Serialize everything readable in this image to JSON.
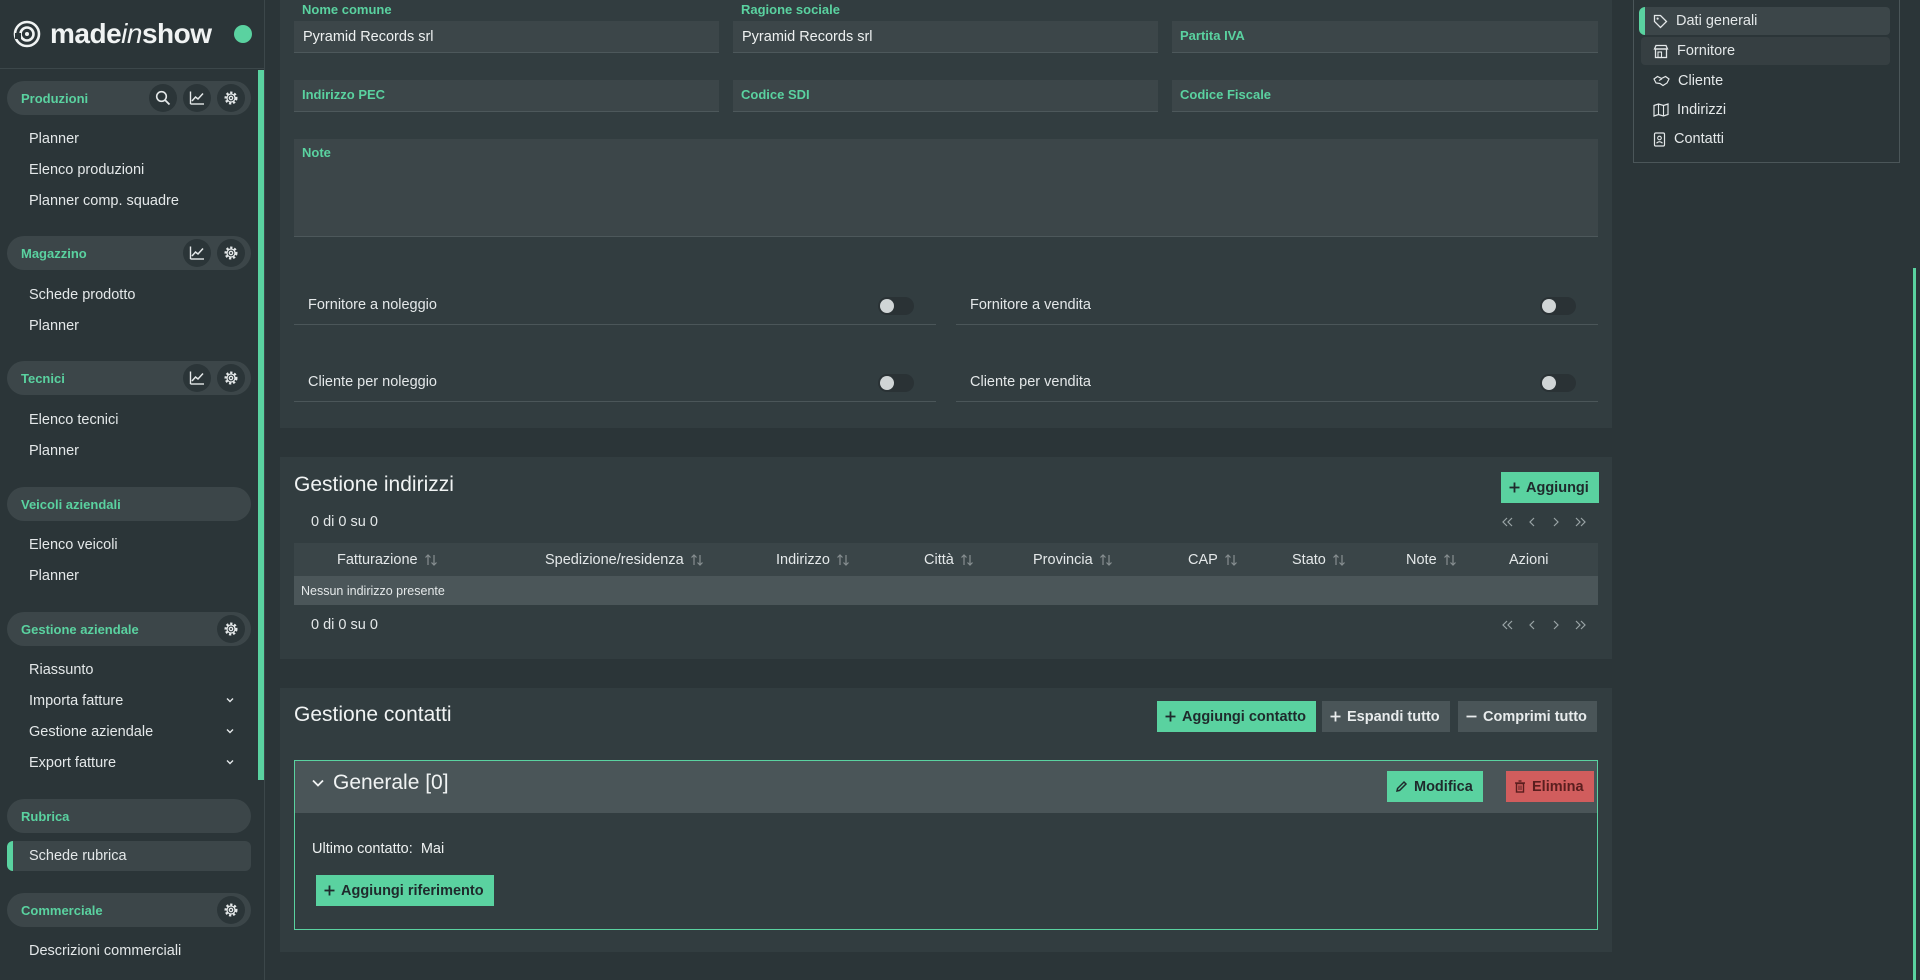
{
  "brand": {
    "prefix": "made",
    "italic": "in",
    "suffix": "show",
    "status_color": "#5ad2a0"
  },
  "sidebar": {
    "sections": [
      {
        "label": "Produzioni",
        "items": [
          "Planner",
          "Elenco produzioni",
          "Planner comp. squadre"
        ]
      },
      {
        "label": "Magazzino",
        "items": [
          "Schede prodotto",
          "Planner"
        ]
      },
      {
        "label": "Tecnici",
        "items": [
          "Elenco tecnici",
          "Planner"
        ]
      },
      {
        "label": "Veicoli aziendali",
        "items": [
          "Elenco veicoli",
          "Planner"
        ]
      },
      {
        "label": "Gestione aziendale",
        "items": [
          "Riassunto",
          "Importa fatture",
          "Gestione aziendale",
          "Export fatture"
        ]
      },
      {
        "label": "Rubrica",
        "items": [
          "Schede rubrica"
        ],
        "active_item": "Schede rubrica"
      },
      {
        "label": "Commerciale",
        "items": [
          "Descrizioni commerciali"
        ]
      }
    ]
  },
  "form": {
    "nome_comune": {
      "label": "Nome comune",
      "value": "Pyramid Records srl"
    },
    "ragione_sociale": {
      "label": "Ragione sociale",
      "value": "Pyramid Records srl"
    },
    "partita_iva": {
      "label": "Partita IVA",
      "value": ""
    },
    "indirizzo_pec": {
      "label": "Indirizzo PEC",
      "value": ""
    },
    "codice_sdi": {
      "label": "Codice SDI",
      "value": ""
    },
    "codice_fiscale": {
      "label": "Codice Fiscale",
      "value": ""
    },
    "note": {
      "label": "Note",
      "value": ""
    },
    "toggles": [
      {
        "label": "Fornitore a noleggio",
        "on": false
      },
      {
        "label": "Fornitore a vendita",
        "on": false
      },
      {
        "label": "Cliente per noleggio",
        "on": false
      },
      {
        "label": "Cliente per vendita",
        "on": false
      }
    ]
  },
  "indirizzi": {
    "title": "Gestione indirizzi",
    "add_label": "Aggiungi",
    "pager_top": "0 di 0 su 0",
    "pager_bottom": "0 di 0 su 0",
    "columns": [
      "Fatturazione",
      "Spedizione/residenza",
      "Indirizzo",
      "Città",
      "Provincia",
      "CAP",
      "Stato",
      "Note",
      "Azioni"
    ],
    "empty_text": "Nessun indirizzo presente"
  },
  "contatti": {
    "title": "Gestione contatti",
    "add_label": "Aggiungi contatto",
    "expand_label": "Espandi tutto",
    "collapse_label": "Comprimi tutto",
    "group": {
      "title": "Generale [0]",
      "edit_label": "Modifica",
      "delete_label": "Elimina",
      "last_contact_label": "Ultimo contatto:",
      "last_contact_value": "Mai",
      "add_ref_label": "Aggiungi riferimento"
    }
  },
  "toc": {
    "items": [
      {
        "label": "Dati generali",
        "icon": "tag-icon",
        "state": "active"
      },
      {
        "label": "Fornitore",
        "icon": "store-icon",
        "state": "hover"
      },
      {
        "label": "Cliente",
        "icon": "handshake-icon",
        "state": ""
      },
      {
        "label": "Indirizzi",
        "icon": "map-icon",
        "state": ""
      },
      {
        "label": "Contatti",
        "icon": "contact-card-icon",
        "state": ""
      }
    ]
  },
  "colors": {
    "accent": "#5ad2a0",
    "danger": "#d15d5d",
    "background": "#2b3538",
    "panel": "#323d40"
  }
}
